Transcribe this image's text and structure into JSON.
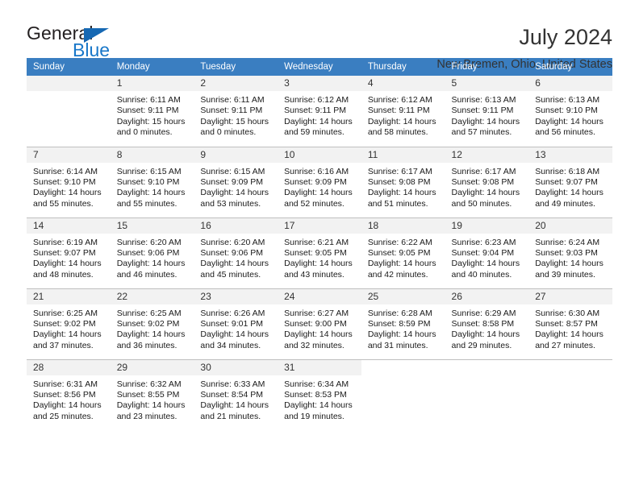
{
  "brand": {
    "name_dark": "General",
    "name_blue": "Blue",
    "accent_color": "#1877c9",
    "triangle_color": "#1668b3"
  },
  "header": {
    "title": "July 2024",
    "subtitle": "New Bremen, Ohio, United States"
  },
  "calendar": {
    "header_bg": "#3a7ec1",
    "daynum_bg": "#f2f2f2",
    "weekday_headers": [
      "Sunday",
      "Monday",
      "Tuesday",
      "Wednesday",
      "Thursday",
      "Friday",
      "Saturday"
    ],
    "weeks": [
      [
        {
          "day": "",
          "sunrise": "",
          "sunset": "",
          "daylight_line1": "",
          "daylight_line2": ""
        },
        {
          "day": "1",
          "sunrise": "Sunrise: 6:11 AM",
          "sunset": "Sunset: 9:11 PM",
          "daylight_line1": "Daylight: 15 hours",
          "daylight_line2": "and 0 minutes."
        },
        {
          "day": "2",
          "sunrise": "Sunrise: 6:11 AM",
          "sunset": "Sunset: 9:11 PM",
          "daylight_line1": "Daylight: 15 hours",
          "daylight_line2": "and 0 minutes."
        },
        {
          "day": "3",
          "sunrise": "Sunrise: 6:12 AM",
          "sunset": "Sunset: 9:11 PM",
          "daylight_line1": "Daylight: 14 hours",
          "daylight_line2": "and 59 minutes."
        },
        {
          "day": "4",
          "sunrise": "Sunrise: 6:12 AM",
          "sunset": "Sunset: 9:11 PM",
          "daylight_line1": "Daylight: 14 hours",
          "daylight_line2": "and 58 minutes."
        },
        {
          "day": "5",
          "sunrise": "Sunrise: 6:13 AM",
          "sunset": "Sunset: 9:11 PM",
          "daylight_line1": "Daylight: 14 hours",
          "daylight_line2": "and 57 minutes."
        },
        {
          "day": "6",
          "sunrise": "Sunrise: 6:13 AM",
          "sunset": "Sunset: 9:10 PM",
          "daylight_line1": "Daylight: 14 hours",
          "daylight_line2": "and 56 minutes."
        }
      ],
      [
        {
          "day": "7",
          "sunrise": "Sunrise: 6:14 AM",
          "sunset": "Sunset: 9:10 PM",
          "daylight_line1": "Daylight: 14 hours",
          "daylight_line2": "and 55 minutes."
        },
        {
          "day": "8",
          "sunrise": "Sunrise: 6:15 AM",
          "sunset": "Sunset: 9:10 PM",
          "daylight_line1": "Daylight: 14 hours",
          "daylight_line2": "and 55 minutes."
        },
        {
          "day": "9",
          "sunrise": "Sunrise: 6:15 AM",
          "sunset": "Sunset: 9:09 PM",
          "daylight_line1": "Daylight: 14 hours",
          "daylight_line2": "and 53 minutes."
        },
        {
          "day": "10",
          "sunrise": "Sunrise: 6:16 AM",
          "sunset": "Sunset: 9:09 PM",
          "daylight_line1": "Daylight: 14 hours",
          "daylight_line2": "and 52 minutes."
        },
        {
          "day": "11",
          "sunrise": "Sunrise: 6:17 AM",
          "sunset": "Sunset: 9:08 PM",
          "daylight_line1": "Daylight: 14 hours",
          "daylight_line2": "and 51 minutes."
        },
        {
          "day": "12",
          "sunrise": "Sunrise: 6:17 AM",
          "sunset": "Sunset: 9:08 PM",
          "daylight_line1": "Daylight: 14 hours",
          "daylight_line2": "and 50 minutes."
        },
        {
          "day": "13",
          "sunrise": "Sunrise: 6:18 AM",
          "sunset": "Sunset: 9:07 PM",
          "daylight_line1": "Daylight: 14 hours",
          "daylight_line2": "and 49 minutes."
        }
      ],
      [
        {
          "day": "14",
          "sunrise": "Sunrise: 6:19 AM",
          "sunset": "Sunset: 9:07 PM",
          "daylight_line1": "Daylight: 14 hours",
          "daylight_line2": "and 48 minutes."
        },
        {
          "day": "15",
          "sunrise": "Sunrise: 6:20 AM",
          "sunset": "Sunset: 9:06 PM",
          "daylight_line1": "Daylight: 14 hours",
          "daylight_line2": "and 46 minutes."
        },
        {
          "day": "16",
          "sunrise": "Sunrise: 6:20 AM",
          "sunset": "Sunset: 9:06 PM",
          "daylight_line1": "Daylight: 14 hours",
          "daylight_line2": "and 45 minutes."
        },
        {
          "day": "17",
          "sunrise": "Sunrise: 6:21 AM",
          "sunset": "Sunset: 9:05 PM",
          "daylight_line1": "Daylight: 14 hours",
          "daylight_line2": "and 43 minutes."
        },
        {
          "day": "18",
          "sunrise": "Sunrise: 6:22 AM",
          "sunset": "Sunset: 9:05 PM",
          "daylight_line1": "Daylight: 14 hours",
          "daylight_line2": "and 42 minutes."
        },
        {
          "day": "19",
          "sunrise": "Sunrise: 6:23 AM",
          "sunset": "Sunset: 9:04 PM",
          "daylight_line1": "Daylight: 14 hours",
          "daylight_line2": "and 40 minutes."
        },
        {
          "day": "20",
          "sunrise": "Sunrise: 6:24 AM",
          "sunset": "Sunset: 9:03 PM",
          "daylight_line1": "Daylight: 14 hours",
          "daylight_line2": "and 39 minutes."
        }
      ],
      [
        {
          "day": "21",
          "sunrise": "Sunrise: 6:25 AM",
          "sunset": "Sunset: 9:02 PM",
          "daylight_line1": "Daylight: 14 hours",
          "daylight_line2": "and 37 minutes."
        },
        {
          "day": "22",
          "sunrise": "Sunrise: 6:25 AM",
          "sunset": "Sunset: 9:02 PM",
          "daylight_line1": "Daylight: 14 hours",
          "daylight_line2": "and 36 minutes."
        },
        {
          "day": "23",
          "sunrise": "Sunrise: 6:26 AM",
          "sunset": "Sunset: 9:01 PM",
          "daylight_line1": "Daylight: 14 hours",
          "daylight_line2": "and 34 minutes."
        },
        {
          "day": "24",
          "sunrise": "Sunrise: 6:27 AM",
          "sunset": "Sunset: 9:00 PM",
          "daylight_line1": "Daylight: 14 hours",
          "daylight_line2": "and 32 minutes."
        },
        {
          "day": "25",
          "sunrise": "Sunrise: 6:28 AM",
          "sunset": "Sunset: 8:59 PM",
          "daylight_line1": "Daylight: 14 hours",
          "daylight_line2": "and 31 minutes."
        },
        {
          "day": "26",
          "sunrise": "Sunrise: 6:29 AM",
          "sunset": "Sunset: 8:58 PM",
          "daylight_line1": "Daylight: 14 hours",
          "daylight_line2": "and 29 minutes."
        },
        {
          "day": "27",
          "sunrise": "Sunrise: 6:30 AM",
          "sunset": "Sunset: 8:57 PM",
          "daylight_line1": "Daylight: 14 hours",
          "daylight_line2": "and 27 minutes."
        }
      ],
      [
        {
          "day": "28",
          "sunrise": "Sunrise: 6:31 AM",
          "sunset": "Sunset: 8:56 PM",
          "daylight_line1": "Daylight: 14 hours",
          "daylight_line2": "and 25 minutes."
        },
        {
          "day": "29",
          "sunrise": "Sunrise: 6:32 AM",
          "sunset": "Sunset: 8:55 PM",
          "daylight_line1": "Daylight: 14 hours",
          "daylight_line2": "and 23 minutes."
        },
        {
          "day": "30",
          "sunrise": "Sunrise: 6:33 AM",
          "sunset": "Sunset: 8:54 PM",
          "daylight_line1": "Daylight: 14 hours",
          "daylight_line2": "and 21 minutes."
        },
        {
          "day": "31",
          "sunrise": "Sunrise: 6:34 AM",
          "sunset": "Sunset: 8:53 PM",
          "daylight_line1": "Daylight: 14 hours",
          "daylight_line2": "and 19 minutes."
        },
        {
          "day": "",
          "sunrise": "",
          "sunset": "",
          "daylight_line1": "",
          "daylight_line2": ""
        },
        {
          "day": "",
          "sunrise": "",
          "sunset": "",
          "daylight_line1": "",
          "daylight_line2": ""
        },
        {
          "day": "",
          "sunrise": "",
          "sunset": "",
          "daylight_line1": "",
          "daylight_line2": ""
        }
      ]
    ]
  }
}
